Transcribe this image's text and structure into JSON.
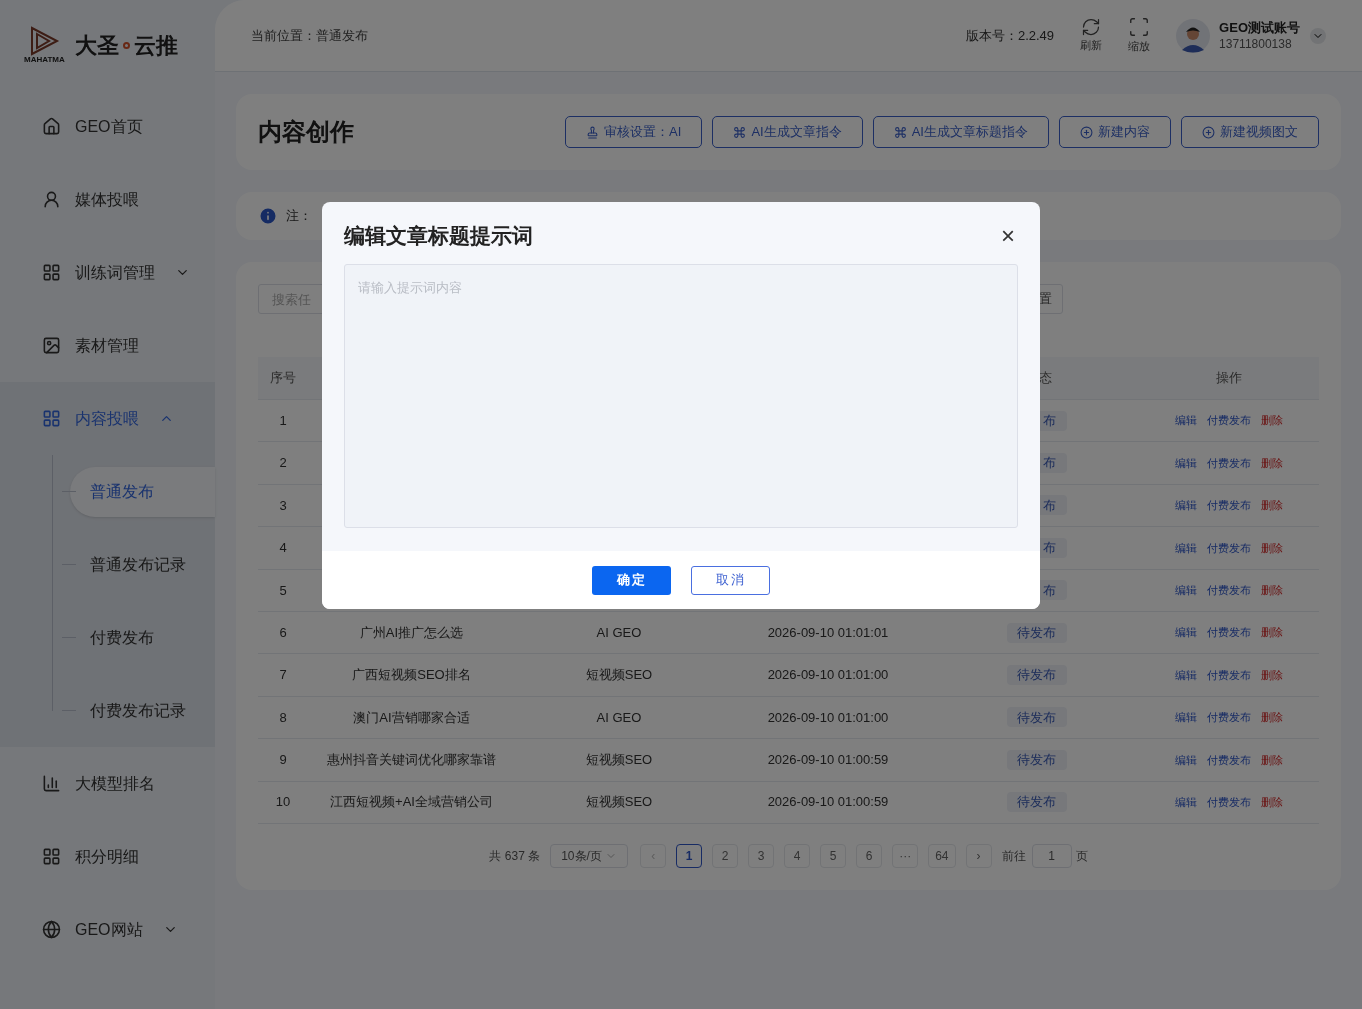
{
  "logo": {
    "mark_caption": "MAHATMA",
    "name_left": "大圣",
    "name_right": "云推"
  },
  "sidebar": {
    "items": [
      {
        "label": "GEO首页",
        "kind": "home",
        "selected": false
      },
      {
        "label": "媒体投喂",
        "kind": "user",
        "selected": false
      },
      {
        "label": "训练词管理",
        "kind": "grid",
        "selected": false,
        "expanded": false
      },
      {
        "label": "素材管理",
        "kind": "image",
        "selected": false
      },
      {
        "label": "内容投喂",
        "kind": "grid",
        "selected": true,
        "expanded": true,
        "children": [
          {
            "label": "普通发布",
            "selected": true
          },
          {
            "label": "普通发布记录",
            "selected": false
          },
          {
            "label": "付费发布",
            "selected": false
          },
          {
            "label": "付费发布记录",
            "selected": false
          }
        ]
      },
      {
        "label": "大模型排名",
        "kind": "chart",
        "selected": false
      },
      {
        "label": "积分明细",
        "kind": "grid",
        "selected": false
      },
      {
        "label": "GEO网站",
        "kind": "browser",
        "selected": false,
        "expanded": false
      }
    ]
  },
  "header": {
    "breadcrumb": "当前位置：普通发布",
    "version": "版本号：2.2.49",
    "refresh": "刷新",
    "zoom": "缩放",
    "user_name": "GEO测试账号",
    "user_phone": "13711800138"
  },
  "page_title": "内容创作",
  "toolbar": [
    {
      "label": "审核设置：AI",
      "kind": "review"
    },
    {
      "label": "AI生成文章指令",
      "kind": "prompt"
    },
    {
      "label": "AI生成文章标题指令",
      "kind": "prompt"
    },
    {
      "label": "新建内容",
      "kind": "create"
    },
    {
      "label": "新建视频图文",
      "kind": "create"
    }
  ],
  "notice": "注：",
  "filter": {
    "placeholder": "搜索任",
    "button": "置"
  },
  "table": {
    "columns": [
      "序号",
      "态",
      "操作"
    ],
    "rows": [
      {
        "index": "1",
        "status": "布",
        "actions": [
          {
            "label": "编辑",
            "kind": "link"
          },
          {
            "label": "付费发布",
            "kind": "link"
          },
          {
            "label": "删除",
            "kind": "danger"
          }
        ]
      },
      {
        "index": "2",
        "status": "布",
        "actions": [
          {
            "label": "编辑",
            "kind": "link"
          },
          {
            "label": "付费发布",
            "kind": "link"
          },
          {
            "label": "删除",
            "kind": "danger"
          }
        ]
      },
      {
        "index": "3",
        "status": "布",
        "actions": [
          {
            "label": "编辑",
            "kind": "link"
          },
          {
            "label": "付费发布",
            "kind": "link"
          },
          {
            "label": "删除",
            "kind": "danger"
          }
        ]
      },
      {
        "index": "4",
        "status": "布",
        "actions": [
          {
            "label": "编辑",
            "kind": "link"
          },
          {
            "label": "付费发布",
            "kind": "link"
          },
          {
            "label": "删除",
            "kind": "danger"
          }
        ]
      },
      {
        "index": "5",
        "status": "布",
        "actions": [
          {
            "label": "编辑",
            "kind": "link"
          },
          {
            "label": "付费发布",
            "kind": "link"
          },
          {
            "label": "删除",
            "kind": "danger"
          }
        ]
      },
      {
        "index": "6",
        "title": "广州AI推广怎么选",
        "category": "AI GEO",
        "time": "2026-09-10 01:01:01",
        "status": "待发布",
        "actions": [
          {
            "label": "编辑",
            "kind": "link"
          },
          {
            "label": "付费发布",
            "kind": "link"
          },
          {
            "label": "删除",
            "kind": "danger"
          }
        ]
      },
      {
        "index": "7",
        "title": "广西短视频SEO排名",
        "category": "短视频SEO",
        "time": "2026-09-10 01:01:00",
        "status": "待发布",
        "actions": [
          {
            "label": "编辑",
            "kind": "link"
          },
          {
            "label": "付费发布",
            "kind": "link"
          },
          {
            "label": "删除",
            "kind": "danger"
          }
        ]
      },
      {
        "index": "8",
        "title": "澳门AI营销哪家合适",
        "category": "AI GEO",
        "time": "2026-09-10 01:01:00",
        "status": "待发布",
        "actions": [
          {
            "label": "编辑",
            "kind": "link"
          },
          {
            "label": "付费发布",
            "kind": "link"
          },
          {
            "label": "删除",
            "kind": "danger"
          }
        ]
      },
      {
        "index": "9",
        "title": "惠州抖音关键词优化哪家靠谱",
        "category": "短视频SEO",
        "time": "2026-09-10 01:00:59",
        "status": "待发布",
        "actions": [
          {
            "label": "编辑",
            "kind": "link"
          },
          {
            "label": "付费发布",
            "kind": "link"
          },
          {
            "label": "删除",
            "kind": "danger"
          }
        ]
      },
      {
        "index": "10",
        "title": "江西短视频+AI全域营销公司",
        "category": "短视频SEO",
        "time": "2026-09-10 01:00:59",
        "status": "待发布",
        "actions": [
          {
            "label": "编辑",
            "kind": "link"
          },
          {
            "label": "付费发布",
            "kind": "link"
          },
          {
            "label": "删除",
            "kind": "danger"
          }
        ]
      }
    ]
  },
  "pagination": {
    "total": "共 637 条",
    "page_size": "10条/页",
    "prev": "‹",
    "pages": [
      {
        "label": "1",
        "selected": true
      },
      {
        "label": "2",
        "selected": false
      },
      {
        "label": "3",
        "selected": false
      },
      {
        "label": "4",
        "selected": false
      },
      {
        "label": "5",
        "selected": false
      },
      {
        "label": "6",
        "selected": false
      },
      {
        "label": "···",
        "selected": false
      },
      {
        "label": "64",
        "selected": false
      }
    ],
    "next": "›",
    "goto_label": "前往",
    "goto_value": "1",
    "goto_suffix": "页"
  },
  "dialog": {
    "title": "编辑文章标题提示词",
    "close": "×",
    "placeholder": "请输入提示词内容",
    "confirm": "确定",
    "cancel": "取消"
  }
}
